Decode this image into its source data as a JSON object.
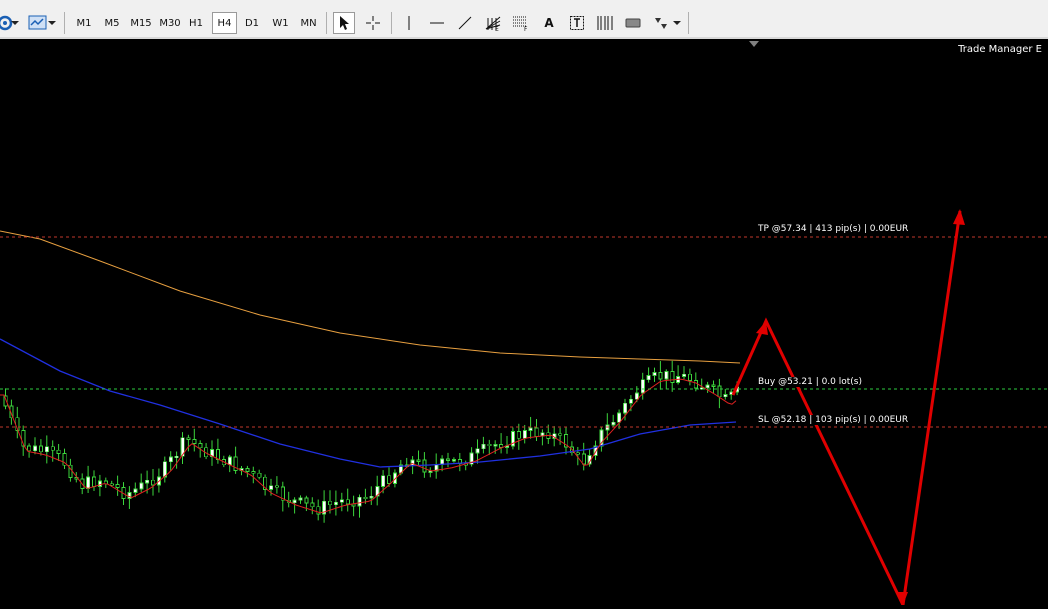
{
  "toolbar": {
    "timeframes": [
      {
        "label": "M1",
        "active": false
      },
      {
        "label": "M5",
        "active": false
      },
      {
        "label": "M15",
        "active": false
      },
      {
        "label": "M30",
        "active": false
      },
      {
        "label": "H1",
        "active": false
      },
      {
        "label": "H4",
        "active": true
      },
      {
        "label": "D1",
        "active": false
      },
      {
        "label": "W1",
        "active": false
      },
      {
        "label": "MN",
        "active": false
      }
    ],
    "tools": [
      "cursor-icon",
      "crosshair-icon",
      "vertical-line-icon",
      "horizontal-line-icon",
      "trendline-icon",
      "fibonacci-fan-icon",
      "fibonacci-retracement-icon",
      "text-icon",
      "text-label-icon",
      "gann-lines-icon",
      "rectangle-icon",
      "shapes-menu-icon"
    ],
    "text_tool_glyph": "A"
  },
  "chart": {
    "ea_name": "Trade Manager E",
    "levels": {
      "tp": {
        "label": "TP @57.34 | 413 pip(s) | 0.00EUR",
        "price": 57.34,
        "color": "#c0392b"
      },
      "buy": {
        "label": "Buy @53.21 | 0.0 lot(s)",
        "price": 53.21,
        "color": "#2ecc40"
      },
      "sl": {
        "label": "SL @52.18 | 103 pip(s) | 0.00EUR",
        "price": 52.18,
        "color": "#c0392b"
      }
    },
    "colors": {
      "bullish": "#ffffff",
      "bearish": "#000000",
      "wick": "#3cd63c",
      "ma_fast": "#e02020",
      "ma_mid": "#2030e0",
      "ma_slow": "#e8a040",
      "forecast_arrow": "#e00000"
    }
  }
}
